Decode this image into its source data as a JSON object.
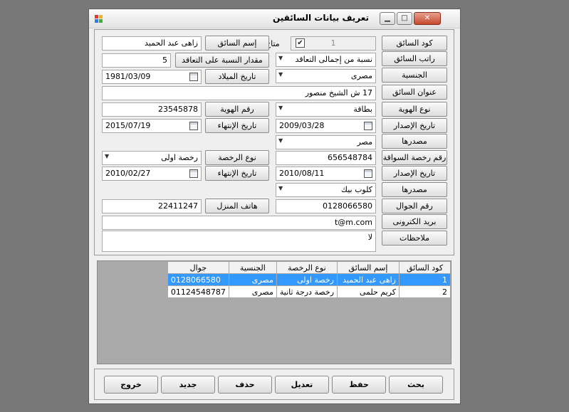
{
  "window": {
    "title": "تعريف بيانات السائقين"
  },
  "form": {
    "driver_code": {
      "label": "كود السائق",
      "value": "1"
    },
    "available": {
      "label": "متاح",
      "checked": true
    },
    "driver_name": {
      "label": "إسم السائق",
      "value": "زاهى عبد الحميد"
    },
    "salary": {
      "label": "راتب السائق",
      "value": "نسبة من إجمالى التعاقد"
    },
    "contract_pct": {
      "label": "مقدار النسبة على التعاقد",
      "value": "5"
    },
    "nationality": {
      "label": "الجنسية",
      "value": "مصرى"
    },
    "birth_date": {
      "label": "تاريخ الميلاد",
      "value": "1981/03/09"
    },
    "address": {
      "label": "عنوان السائق",
      "value": "17 ش الشيخ منصور"
    },
    "id_type": {
      "label": "نوع الهوية",
      "value": "بطاقة"
    },
    "id_number": {
      "label": "رقم الهوية",
      "value": "23545878"
    },
    "id_issue_date": {
      "label": "تاريخ الإصدار",
      "value": "2009/03/28"
    },
    "id_expiry_date": {
      "label": "تاريخ الإنتهاء",
      "value": "2015/07/19"
    },
    "id_source": {
      "label": "مصدرها",
      "value": "مصر"
    },
    "license_number": {
      "label": "رقم رخصة السواقة",
      "value": "656548784"
    },
    "license_type": {
      "label": "نوع الرخصة",
      "value": "رخصة اولى"
    },
    "license_issue_date": {
      "label": "تاريخ الإصدار",
      "value": "2010/08/11"
    },
    "license_expiry_date": {
      "label": "تاريخ الإنتهاء",
      "value": "2010/02/27"
    },
    "license_source": {
      "label": "مصدرها",
      "value": "كلوب بيك"
    },
    "mobile": {
      "label": "رقم الجوال",
      "value": "0128066580"
    },
    "home_phone": {
      "label": "هاتف المنزل",
      "value": "22411247"
    },
    "email": {
      "label": "بريد الكترونى",
      "value": "t@m.com"
    },
    "notes": {
      "label": "ملاحظات",
      "value": "لا"
    }
  },
  "grid": {
    "columns": [
      "كود السائق",
      "إسم السائق",
      "نوع الرخصة",
      "الجنسية",
      "جوال"
    ],
    "rows": [
      [
        "1",
        "زاهى عبد الحميد",
        "رخصة اولى",
        "مصرى",
        "0128066580"
      ],
      [
        "2",
        "كريم حلمى",
        "رخصة درجة ثانية",
        "مصرى",
        "01124548787"
      ]
    ],
    "selected_row": 0
  },
  "buttons": {
    "search": "بحث",
    "save": "حفظ",
    "edit": "تعديل",
    "delete": "حذف",
    "new": "جديد",
    "exit": "خروج"
  },
  "colors": {
    "selection": "#3399ff",
    "close_button": "#c54a2e"
  }
}
